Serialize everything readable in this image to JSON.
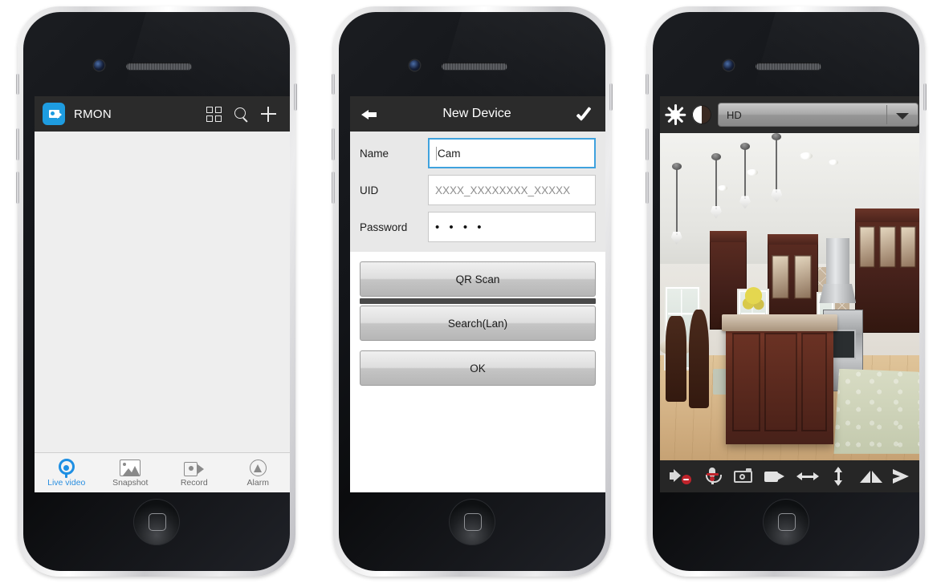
{
  "phone1": {
    "navbar": {
      "app_icon": "camcorder-app-icon",
      "title": "RMON",
      "grid_icon": "grid-view-icon",
      "search_icon": "search-icon",
      "add_icon": "plus-icon"
    },
    "list": {
      "items": []
    },
    "tabs": [
      {
        "label": "Live video",
        "icon": "live-video-icon",
        "active": true
      },
      {
        "label": "Snapshot",
        "icon": "snapshot-icon",
        "active": false
      },
      {
        "label": "Record",
        "icon": "record-icon",
        "active": false
      },
      {
        "label": "Alarm",
        "icon": "alarm-icon",
        "active": false
      }
    ],
    "colors": {
      "accent": "#2a8fe0",
      "navbar": "#2b2b2b",
      "list_bg": "#eeeeee"
    }
  },
  "phone2": {
    "navbar": {
      "back_icon": "back-arrow-icon",
      "title": "New Device",
      "confirm_icon": "checkmark-icon"
    },
    "form": {
      "fields": [
        {
          "label": "Name",
          "value": "Cam",
          "placeholder": "",
          "focused": true
        },
        {
          "label": "UID",
          "value": "",
          "placeholder": "XXXX_XXXXXXXX_XXXXX",
          "focused": false
        },
        {
          "label": "Password",
          "value": "• • • •",
          "placeholder": "",
          "focused": false
        }
      ]
    },
    "buttons": [
      {
        "label": "QR Scan"
      },
      {
        "label": "Search(Lan)"
      },
      {
        "label": "OK"
      }
    ],
    "colors": {
      "navbar": "#2b2b2b",
      "form_bg": "#e8e8e8",
      "focus_border": "#3fa2de"
    }
  },
  "phone3": {
    "topbar": {
      "brightness_icon": "brightness-sun-icon",
      "contrast_icon": "contrast-icon",
      "quality_dropdown": {
        "value": "HD",
        "chevron_icon": "chevron-down-icon"
      }
    },
    "video": {
      "scene": "kitchen-live-view"
    },
    "toolbar": [
      {
        "name": "speaker-muted-icon",
        "label": "Speaker"
      },
      {
        "name": "microphone-muted-icon",
        "label": "Microphone"
      },
      {
        "name": "snapshot-camera-icon",
        "label": "Snapshot"
      },
      {
        "name": "record-camcorder-icon",
        "label": "Record"
      },
      {
        "name": "pan-horizontal-icon",
        "label": "Pan"
      },
      {
        "name": "tilt-vertical-icon",
        "label": "Tilt"
      },
      {
        "name": "mirror-icon",
        "label": "Mirror"
      },
      {
        "name": "flip-icon",
        "label": "Flip"
      }
    ],
    "colors": {
      "topbar": "#2a2a2a",
      "toolbar": "#262626",
      "mute_badge": "#c0232b"
    }
  }
}
